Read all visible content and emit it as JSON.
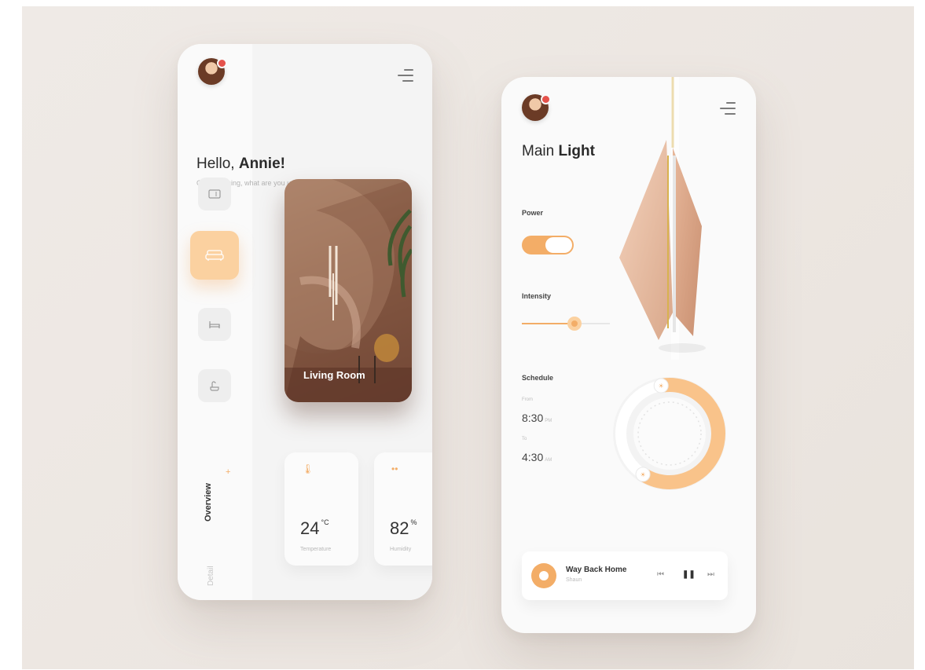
{
  "home": {
    "greeting_prefix": "Hello,",
    "greeting_name": "Annie!",
    "subtitle": "Good evening, what are you up to?",
    "room_tabs": [
      {
        "icon": "tv-icon",
        "active": false
      },
      {
        "icon": "sofa-icon",
        "active": true
      },
      {
        "icon": "bed-icon",
        "active": false
      },
      {
        "icon": "bath-icon",
        "active": false
      }
    ],
    "room_card": {
      "label": "Living Room"
    },
    "nav_overview": "Overview",
    "nav_detail": "Detail",
    "stats": [
      {
        "icon": "thermometer-icon",
        "value": "24",
        "unit": "°C",
        "label": "Temperature"
      },
      {
        "icon": "droplet-icon",
        "value": "82",
        "unit": "%",
        "label": "Humidity"
      }
    ]
  },
  "light": {
    "title_prefix": "Main",
    "title_strong": "Light",
    "power_label": "Power",
    "power_on": true,
    "intensity_label": "Intensity",
    "intensity_value": 0.6,
    "schedule_label": "Schedule",
    "from_label": "From",
    "from_time": "8:30",
    "from_suffix": "PM",
    "to_label": "To",
    "to_time": "4:30",
    "to_suffix": "AM",
    "schedule_fraction": 0.62
  },
  "player": {
    "title": "Way Back Home",
    "artist": "Shaun"
  },
  "colors": {
    "accent": "#f3ad67",
    "accent_light": "#fbd1a0",
    "background": "#efeae6"
  }
}
